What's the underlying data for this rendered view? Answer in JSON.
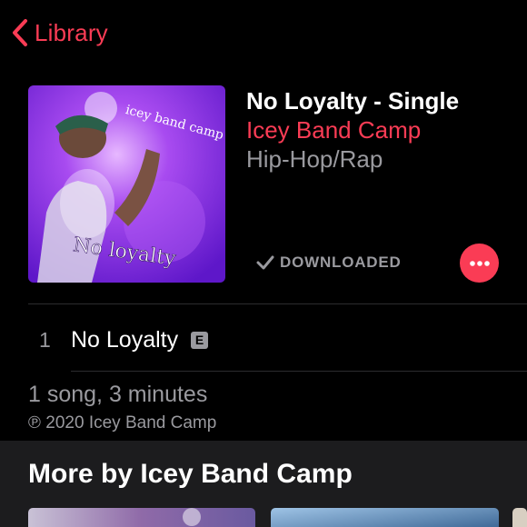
{
  "nav": {
    "back_label": "Library"
  },
  "album": {
    "title": "No Loyalty - Single",
    "artist": "Icey Band Camp",
    "genre": "Hip-Hop/Rap",
    "artwork_text_top": "icey band camp",
    "artwork_text_bottom": "No loyalty"
  },
  "status": {
    "downloaded_label": "DOWNLOADED"
  },
  "tracks": [
    {
      "number": "1",
      "title": "No Loyalty",
      "explicit_badge": "E"
    }
  ],
  "summary": "1 song, 3 minutes",
  "copyright": "℗ 2020 Icey Band Camp",
  "more_by": {
    "title": "More by Icey Band Camp"
  },
  "colors": {
    "accent": "#fa3c55",
    "secondary_text": "#9a9a9f",
    "background": "#000000",
    "section_background": "#1c1c1e"
  },
  "icons": [
    "chevron-left-icon",
    "checkmark-icon",
    "ellipsis-icon"
  ]
}
